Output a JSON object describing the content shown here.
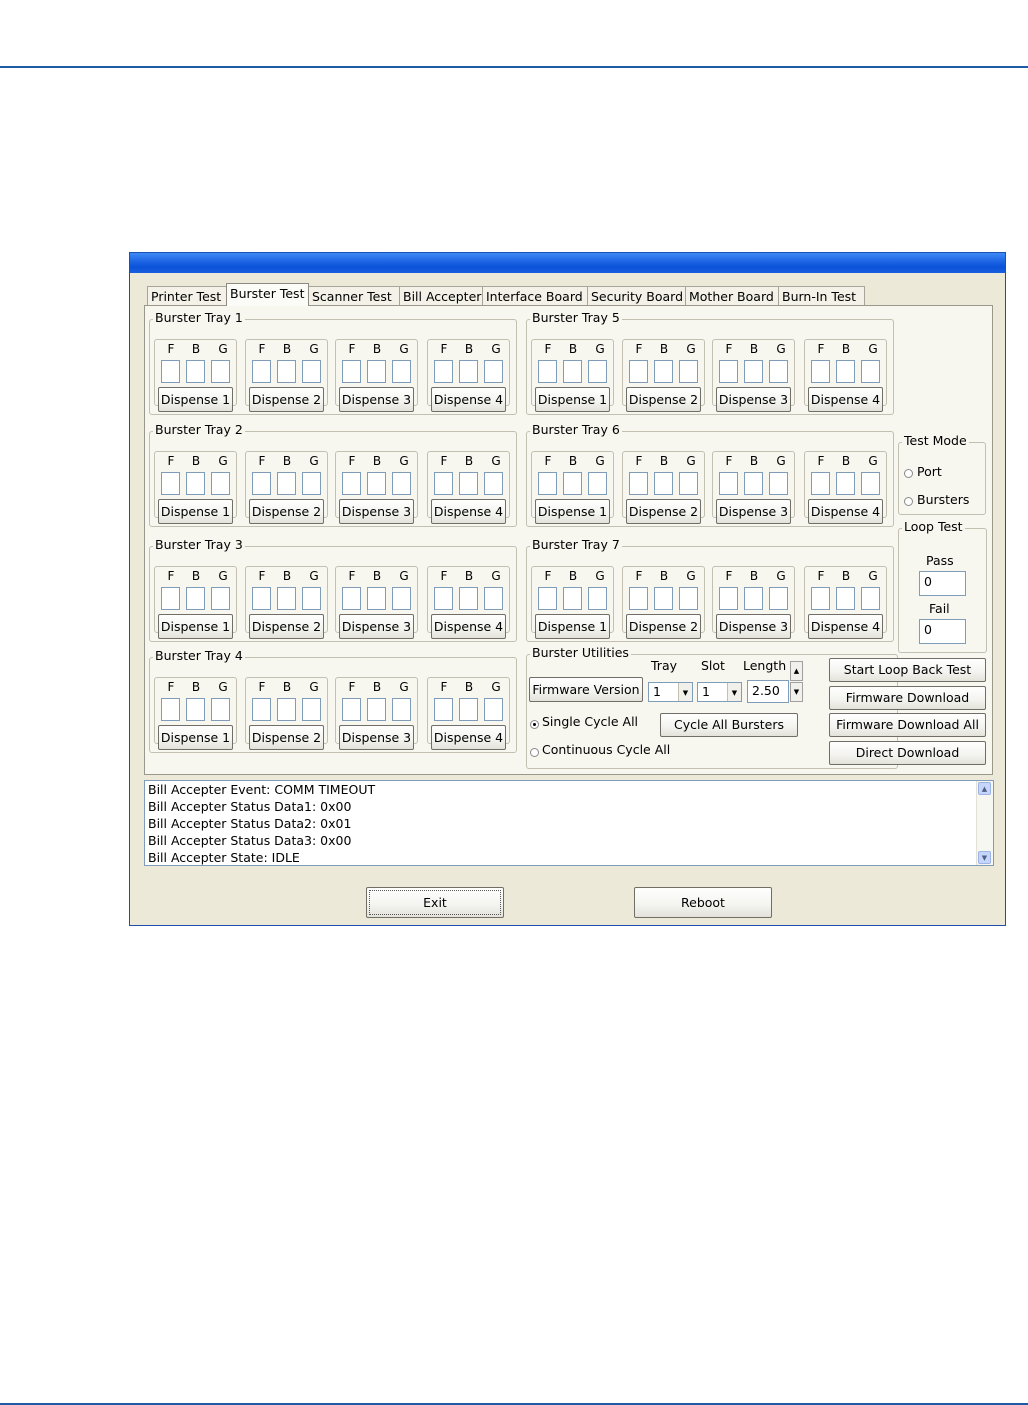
{
  "tabs": [
    "Printer Test",
    "Burster Test",
    "Scanner Test",
    "Bill Accepter",
    "Interface Board",
    "Security Board",
    "Mother Board",
    "Burn-In Test"
  ],
  "active_tab": "Burster Test",
  "slot_labels": {
    "f": "F",
    "b": "B",
    "g": "G"
  },
  "trays": [
    {
      "title": "Burster Tray 1",
      "buttons": [
        "Dispense 1",
        "Dispense 2",
        "Dispense 3",
        "Dispense 4"
      ]
    },
    {
      "title": "Burster Tray 2",
      "buttons": [
        "Dispense 1",
        "Dispense 2",
        "Dispense 3",
        "Dispense 4"
      ]
    },
    {
      "title": "Burster Tray 3",
      "buttons": [
        "Dispense 1",
        "Dispense 2",
        "Dispense 3",
        "Dispense 4"
      ]
    },
    {
      "title": "Burster Tray 4",
      "buttons": [
        "Dispense 1",
        "Dispense 2",
        "Dispense 3",
        "Dispense 4"
      ]
    },
    {
      "title": "Burster Tray 5",
      "buttons": [
        "Dispense 1",
        "Dispense 2",
        "Dispense 3",
        "Dispense 4"
      ]
    },
    {
      "title": "Burster Tray 6",
      "buttons": [
        "Dispense 1",
        "Dispense 2",
        "Dispense 3",
        "Dispense 4"
      ]
    },
    {
      "title": "Burster Tray 7",
      "buttons": [
        "Dispense 1",
        "Dispense 2",
        "Dispense 3",
        "Dispense 4"
      ]
    }
  ],
  "test_mode": {
    "title": "Test Mode",
    "options": [
      "Port",
      "Bursters"
    ],
    "selected": null
  },
  "loop_test": {
    "title": "Loop Test",
    "pass_label": "Pass",
    "pass_value": "0",
    "fail_label": "Fail",
    "fail_value": "0"
  },
  "utilities": {
    "title": "Burster Utilities",
    "firmware_version_button": "Firmware Version",
    "tray_label": "Tray",
    "tray_value": "1",
    "slot_label": "Slot",
    "slot_value": "1",
    "length_label": "Length",
    "length_value": "2.50",
    "single_cycle_label": "Single Cycle All",
    "continuous_cycle_label": "Continuous Cycle All",
    "cycle_mode_selected": "Single Cycle All",
    "cycle_all_button": "Cycle All Bursters"
  },
  "right_buttons": [
    "Start Loop Back Test",
    "Firmware Download",
    "Firmware Download All",
    "Direct Download"
  ],
  "log_lines": [
    "Bill Accepter Event: COMM TIMEOUT",
    "Bill Accepter Status Data1: 0x00",
    "Bill Accepter Status Data2: 0x01",
    "Bill Accepter Status Data3: 0x00",
    "Bill Accepter State: IDLE"
  ],
  "footer": {
    "exit_label": "Exit",
    "reboot_label": "Reboot"
  },
  "icons": {
    "combo_arrow": "chevron-down-icon",
    "spin_up": "spin-up-icon",
    "spin_down": "spin-down-icon",
    "scroll_up": "scroll-up-icon",
    "scroll_down": "scroll-down-icon"
  },
  "colors": {
    "title_bar": "#0a52d8",
    "window_bg": "#ece9d8",
    "page_rule": "#1f5aa6"
  }
}
